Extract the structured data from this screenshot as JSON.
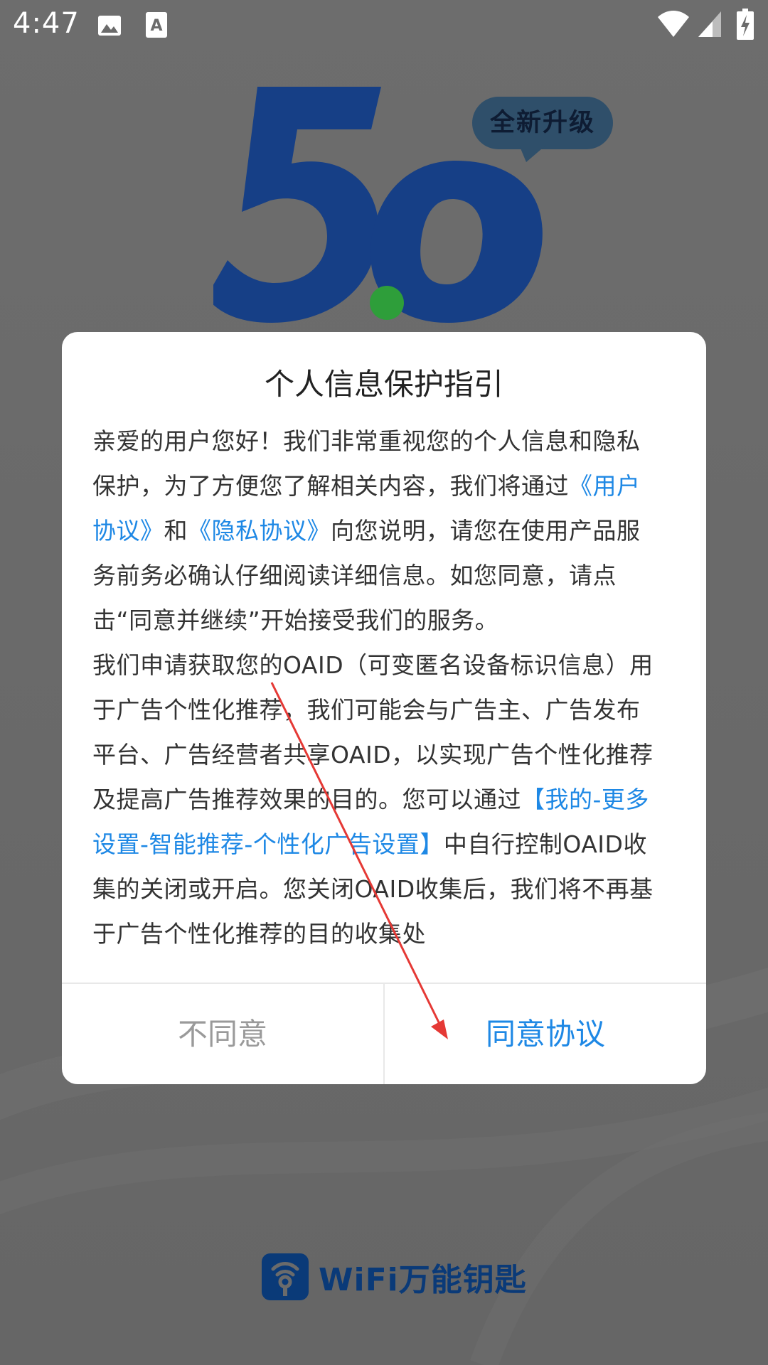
{
  "status_bar": {
    "time": "4:47",
    "icons": [
      "image-icon",
      "text-a-icon",
      "wifi-icon",
      "signal-icon",
      "battery-charging-icon"
    ]
  },
  "splash": {
    "version_text": "5.0",
    "badge_text": "全新升级",
    "brand_name": "WiFi万能钥匙",
    "colors": {
      "logo_blue": "#0f3a86",
      "dot_green": "#2e9e3a",
      "link_blue": "#1e88e5"
    }
  },
  "dialog": {
    "title": "个人信息保护指引",
    "paragraph1": {
      "part1": "亲爱的用户您好！我们非常重视您的个人信息和隐私保护，为了方便您了解相关内容，我们将通过",
      "link_user_agreement": "《用户协议》",
      "and": "和",
      "link_privacy_agreement": "《隐私协议》",
      "part2": "向您说明，请您在使用产品服务前务必确认仔细阅读详细信息。如您同意，请点击“同意并继续”开始接受我们的服务。"
    },
    "paragraph2": {
      "part1": "我们申请获取您的OAID（可变匿名设备标识信息）用于广告个性化推荐，我们可能会与广告主、广告发布平台、广告经营者共享OAID，以实现广告个性化推荐及提高广告推荐效果的目的。您可以通过",
      "link_settings": "【我的-更多设置-智能推荐-个性化广告设置】",
      "part2": "中自行控制OAID收集的关闭或开启。您关闭OAID收集后，我们将不再基于广告个性化推荐的目的收集处"
    },
    "disagree_label": "不同意",
    "agree_label": "同意协议"
  }
}
